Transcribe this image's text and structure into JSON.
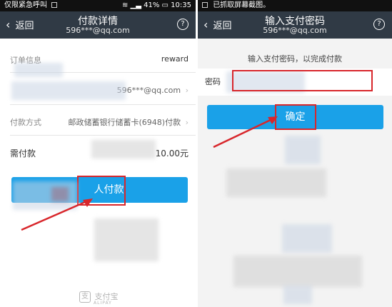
{
  "left": {
    "status": {
      "carrier": "仅限紧急呼叫",
      "battery": "41%",
      "time": "10:35"
    },
    "nav": {
      "back": "返回",
      "title": "付款详情",
      "account": "596***@qq.com",
      "help": "?"
    },
    "rows": {
      "order_label": "订单信息",
      "order_value": "reward",
      "account_value": "596***@qq.com",
      "method_label": "付款方式",
      "method_value": "邮政储蓄银行储蓄卡(6948)付款",
      "due_label": "需付款",
      "due_value": "10.00元"
    },
    "pay_button": "人付款",
    "logo": {
      "mark": "支",
      "name": "支付宝",
      "en": "ALIPAY"
    }
  },
  "right": {
    "status": {
      "notice": "已抓取屏幕截图。"
    },
    "nav": {
      "back": "返回",
      "title": "输入支付密码",
      "account": "596***@qq.com",
      "help": "?"
    },
    "hint": "输入支付密码，以完成付款",
    "password_label": "密码",
    "confirm_button": "确定"
  },
  "colors": {
    "nav_bg": "#303a45",
    "button": "#1aa1e8",
    "highlight": "#d8262b"
  },
  "icons": [
    "back-chevron-icon",
    "help-icon",
    "wifi-icon",
    "battery-icon",
    "alipay-logo-icon"
  ]
}
